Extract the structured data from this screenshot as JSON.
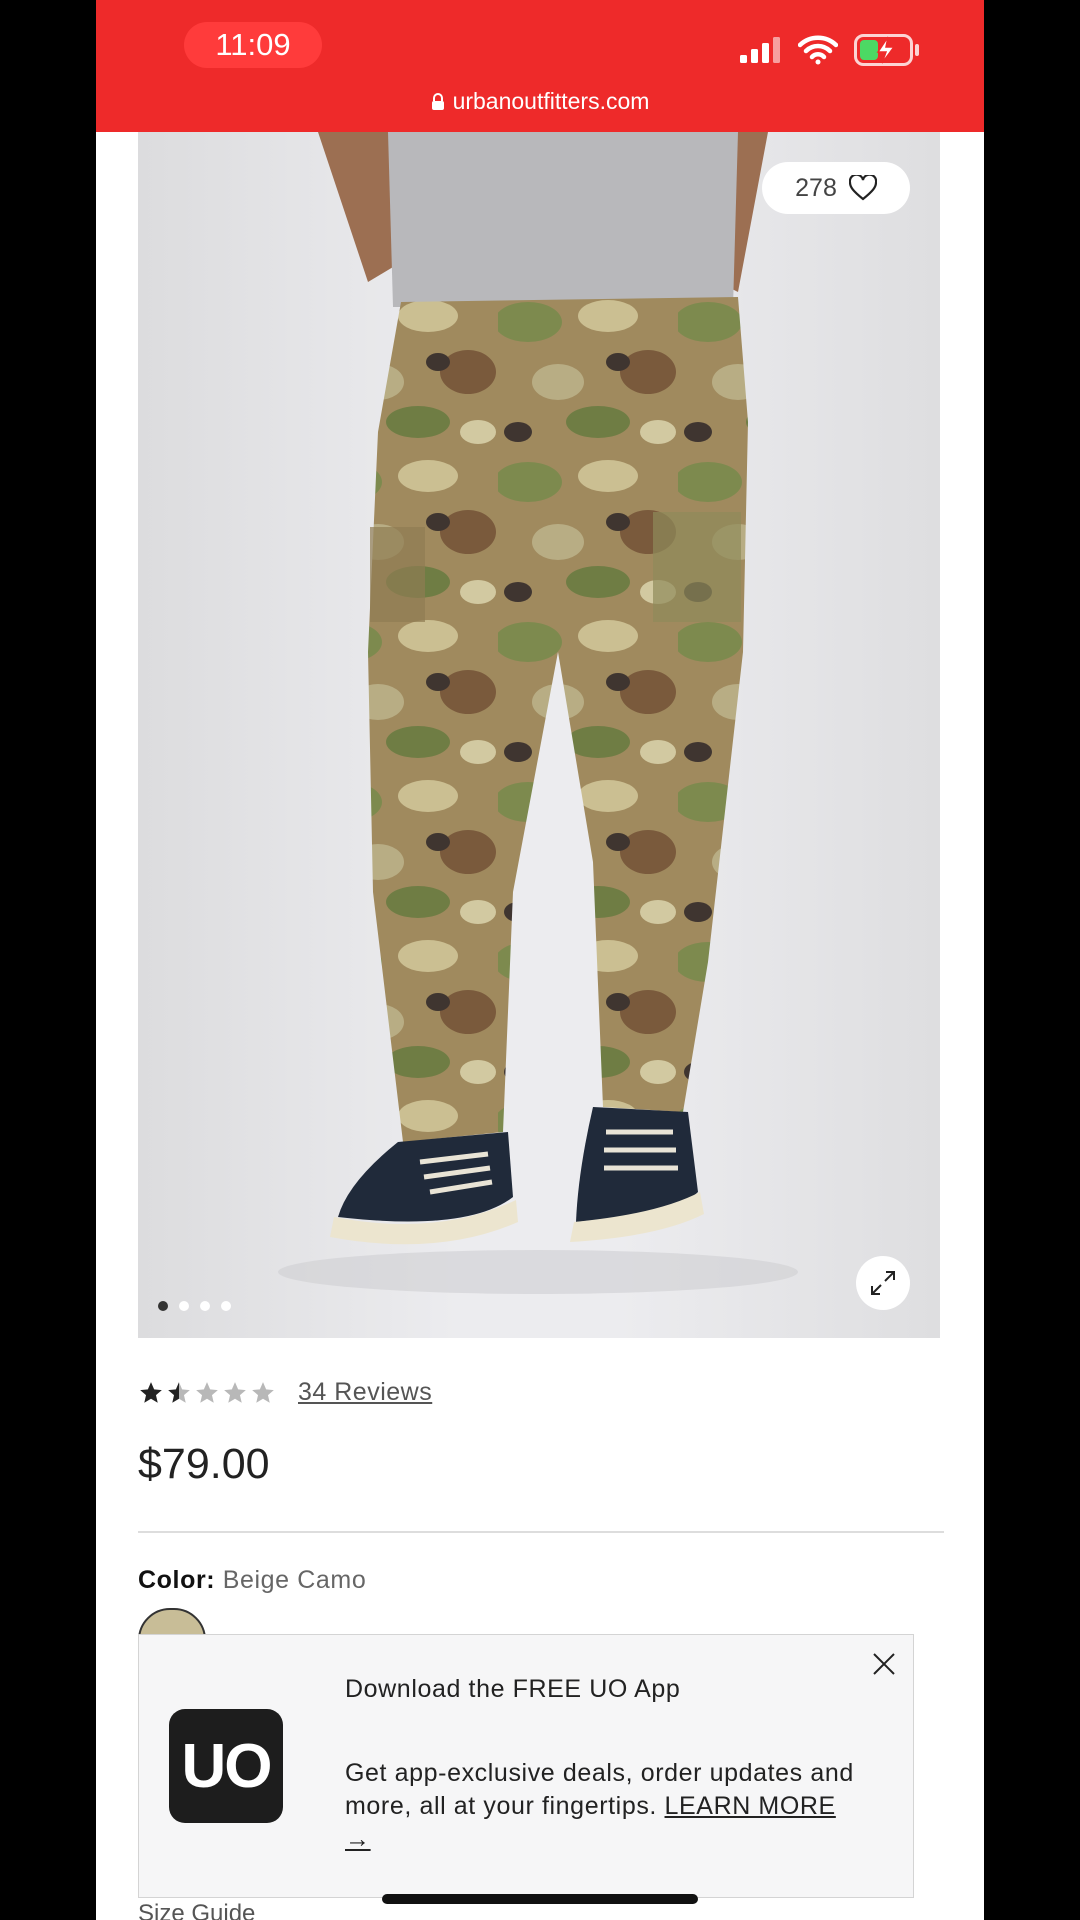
{
  "status_bar": {
    "time": "11:09",
    "url": "urbanoutfitters.com"
  },
  "product": {
    "like_count": "278",
    "image_count": 4,
    "active_image": 1,
    "rating": 1.5,
    "rating_max": 5,
    "reviews_label": "34 Reviews",
    "price": "$79.00",
    "color_label": "Color:",
    "color_value": "Beige Camo",
    "swatch_color": "#c8bd97",
    "size_guide": "Size Guide"
  },
  "app_banner": {
    "logo_text": "UO",
    "title": "Download the FREE UO App",
    "body": "Get app-exclusive deals, order updates and more, all at your fingertips.",
    "link": "LEARN MORE →"
  },
  "colors": {
    "status_bar_bg": "#ee2a2a",
    "text_dark": "#222222"
  }
}
